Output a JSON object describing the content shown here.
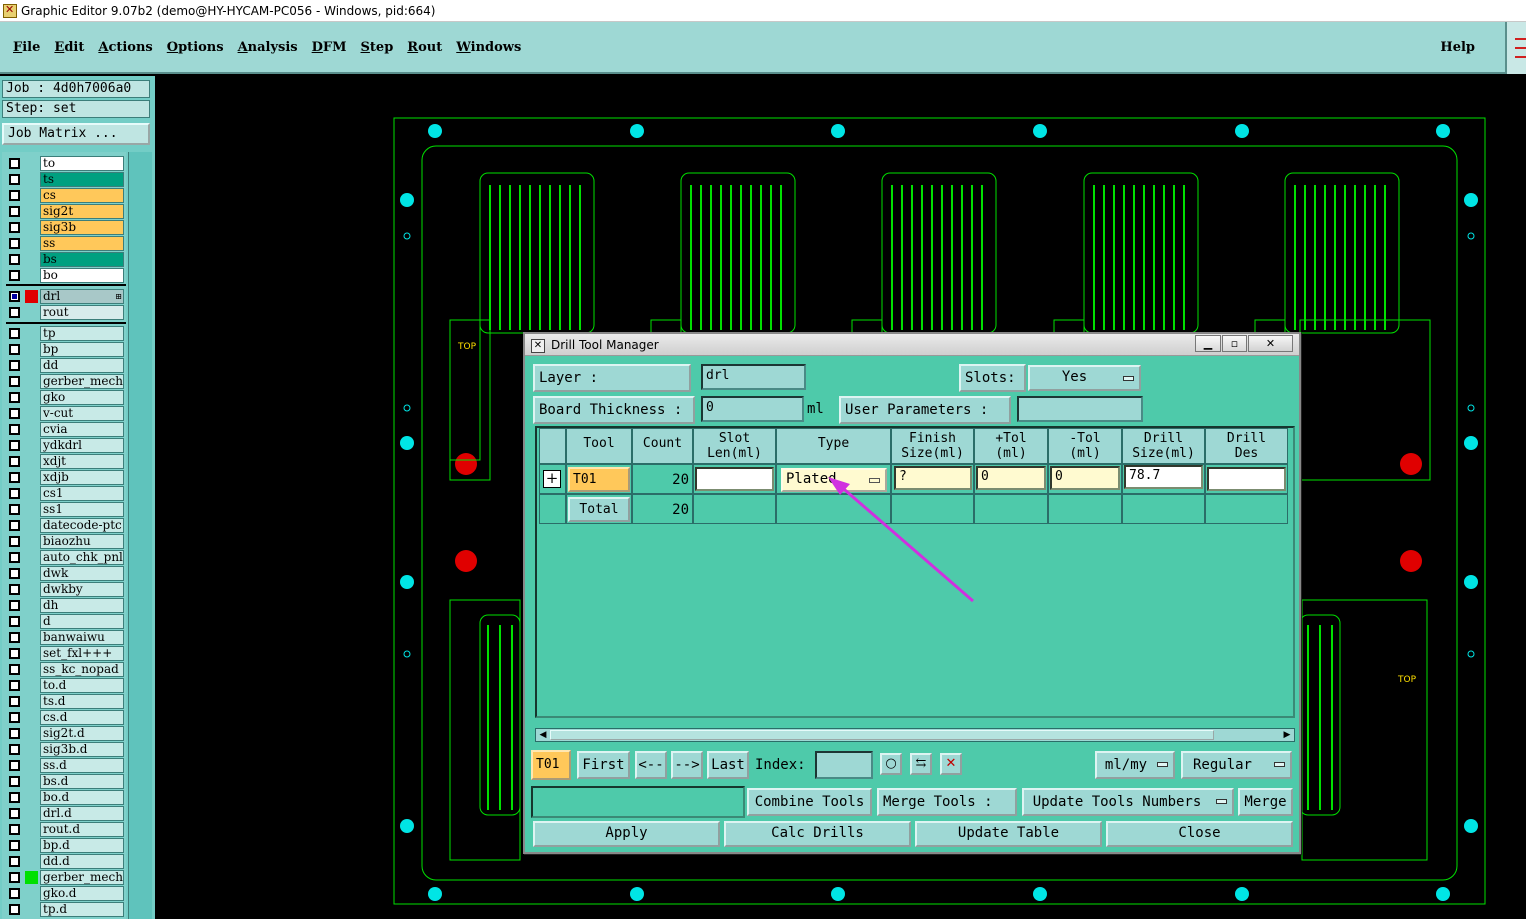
{
  "window": {
    "title": "Graphic Editor 9.07b2 (demo@HY-HYCAM-PC056 - Windows, pid:664)"
  },
  "menubar": {
    "items": [
      {
        "name": "File",
        "ul": "F",
        "rest": "ile"
      },
      {
        "name": "Edit",
        "ul": "E",
        "rest": "dit"
      },
      {
        "name": "Actions",
        "ul": "A",
        "rest": "ctions"
      },
      {
        "name": "Options",
        "ul": "O",
        "rest": "ptions"
      },
      {
        "name": "Analysis",
        "ul": "A",
        "rest": "nalysis"
      },
      {
        "name": "DFM",
        "ul": "D",
        "rest": "FM"
      },
      {
        "name": "Step",
        "ul": "S",
        "rest": "tep"
      },
      {
        "name": "Rout",
        "ul": "R",
        "rest": "out"
      },
      {
        "name": "Windows",
        "ul": "W",
        "rest": "indows"
      }
    ],
    "help": "Help"
  },
  "left": {
    "job": "Job : 4d0h7006a0",
    "step": "Step:  set",
    "job_matrix": "Job Matrix ...",
    "layers_group1": [
      {
        "name": "to",
        "color": "white"
      },
      {
        "name": "ts",
        "color": "teal"
      },
      {
        "name": "cs",
        "color": "orange"
      },
      {
        "name": "sig2t",
        "color": "orange"
      },
      {
        "name": "sig3b",
        "color": "orange"
      },
      {
        "name": "ss",
        "color": "orange"
      },
      {
        "name": "bs",
        "color": "teal"
      },
      {
        "name": "bo",
        "color": "white"
      }
    ],
    "layers_group2": [
      {
        "name": "drl",
        "color": "grey"
      },
      {
        "name": "rout",
        "color": "light"
      }
    ],
    "layers_group3": [
      "tp",
      "bp",
      "dd",
      "gerber_mechanical",
      "gko",
      "v-cut",
      "cvia",
      "ydkdrl",
      "xdjt",
      "xdjb",
      "cs1",
      "ss1",
      "datecode-ptc",
      "biaozhu",
      "auto_chk_pnl",
      "dwk",
      "dwkby",
      "dh",
      "d",
      "banwaiwu",
      "set_fxl+++",
      "ss_kc_nopad",
      "to.d",
      "ts.d",
      "cs.d",
      "sig2t.d",
      "sig3b.d",
      "ss.d",
      "bs.d",
      "bo.d",
      "drl.d",
      "rout.d",
      "bp.d",
      "dd.d",
      "gerber_mechanical",
      "gko.d",
      "tp.d"
    ]
  },
  "canvas": {
    "label_top": "TOP",
    "label_top_right": "TOP"
  },
  "dialog": {
    "title": "Drill Tool Manager",
    "layer_label": "Layer          :",
    "layer_value": "drl",
    "slots_label": "Slots:",
    "slots_value": "Yes",
    "board_thickness_label": "Board Thickness :",
    "board_thickness_value": "0",
    "board_thickness_unit": "ml",
    "user_params_label": "User Parameters :",
    "user_params_value": "",
    "columns": {
      "tool": "Tool",
      "count": "Count",
      "slot_len": "Slot\nLen(ml)",
      "type": "Type",
      "finish_size": "Finish\nSize(ml)",
      "plus_tol": "+Tol\n(ml)",
      "minus_tol": "-Tol\n(ml)",
      "drill_size": "Drill\nSize(ml)",
      "drill_des": "Drill\nDes"
    },
    "row": {
      "tool": "T01",
      "count": "20",
      "slot_len": "",
      "type": "Plated",
      "finish_size": "?",
      "plus_tol": "0",
      "minus_tol": "0",
      "drill_size": "78.7",
      "drill_des": ""
    },
    "total": {
      "label": "Total",
      "count": "20"
    },
    "nav": {
      "current": "T01",
      "first": "First",
      "prev": "<--",
      "next": "-->",
      "last": "Last",
      "index_label": "Index:",
      "index_value": "",
      "units": "ml/my",
      "mode": "Regular"
    },
    "tools_row": {
      "combine": "Combine Tools",
      "merge_label": "Merge Tools :",
      "update_numbers": "Update Tools Numbers",
      "merge": "Merge"
    },
    "bottom": {
      "apply": "Apply",
      "calc": "Calc Drills",
      "update": "Update Table",
      "close": "Close"
    }
  },
  "colors": {
    "trace": "#00e000",
    "fiducial": "#00e5e5",
    "drill_red": "#e00000",
    "arrow": "#d030e0",
    "dialog_bg": "#4ecaaa",
    "panel_bg": "#9ed8d4"
  }
}
